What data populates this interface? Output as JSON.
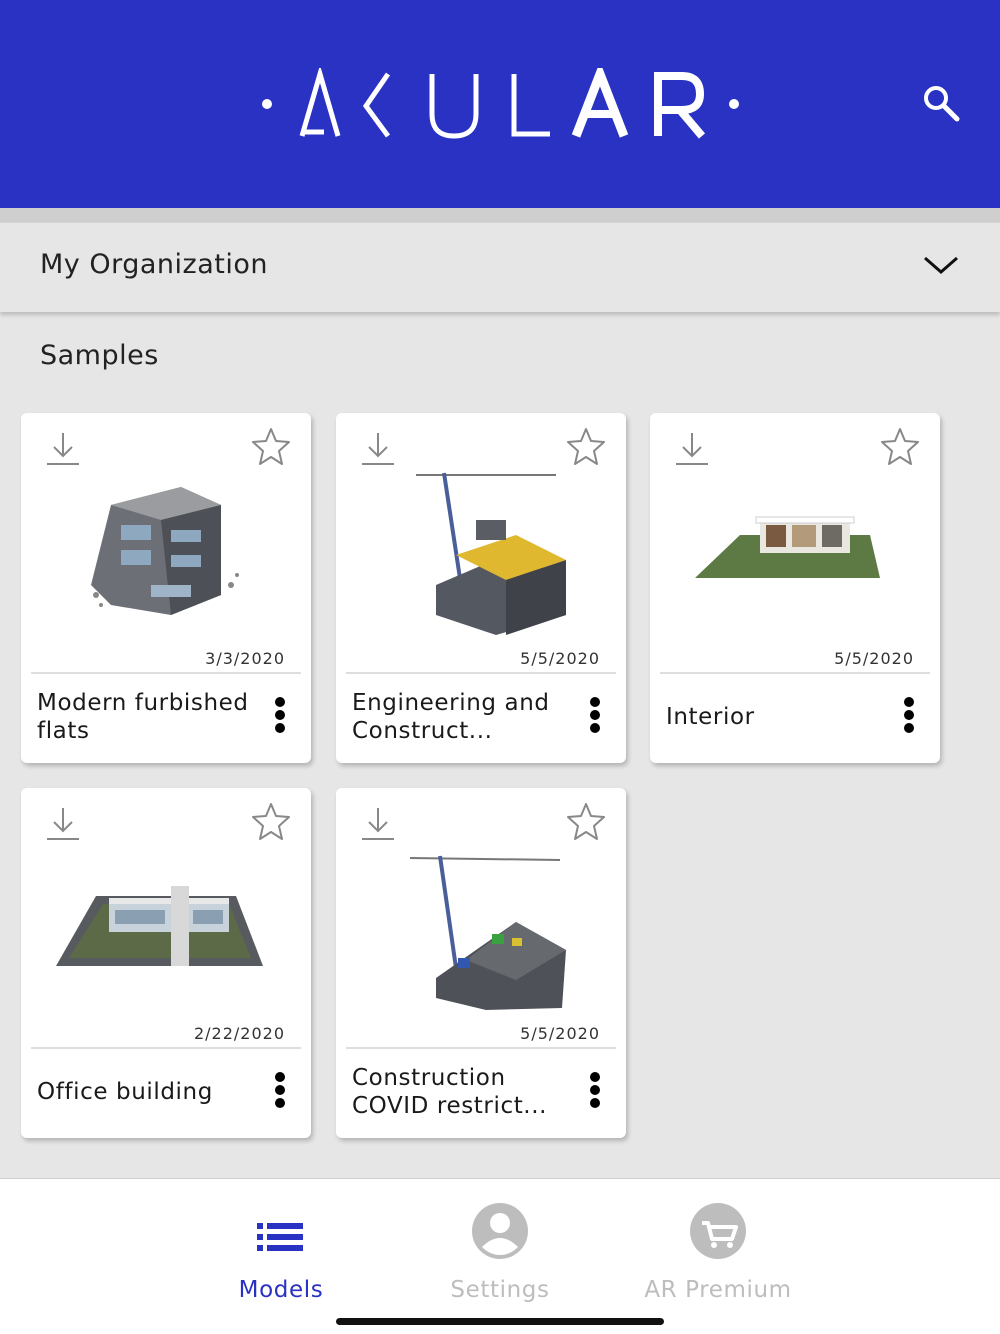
{
  "header": {
    "logo_text": "AKULAR",
    "brand_color": "#2a32c4",
    "search_icon": "search-icon"
  },
  "org_selector": {
    "label": "My Organization",
    "icon": "chevron-down-icon"
  },
  "section": {
    "title": "Samples"
  },
  "models": [
    {
      "name": "Modern furbished flats",
      "date": "3/3/2020"
    },
    {
      "name": "Engineering and Construct...",
      "date": "5/5/2020"
    },
    {
      "name": "Interior",
      "date": "5/5/2020"
    },
    {
      "name": "Office building",
      "date": "2/22/2020"
    },
    {
      "name": "Construction COVID restrict...",
      "date": "5/5/2020"
    }
  ],
  "bottom_nav": {
    "items": [
      {
        "label": "Models",
        "icon": "list-icon",
        "active": true,
        "color": "#2a32c4"
      },
      {
        "label": "Settings",
        "icon": "user-icon",
        "active": false,
        "color": "#bdbdbd"
      },
      {
        "label": "AR Premium",
        "icon": "cart-icon",
        "active": false,
        "color": "#bdbdbd"
      }
    ]
  }
}
